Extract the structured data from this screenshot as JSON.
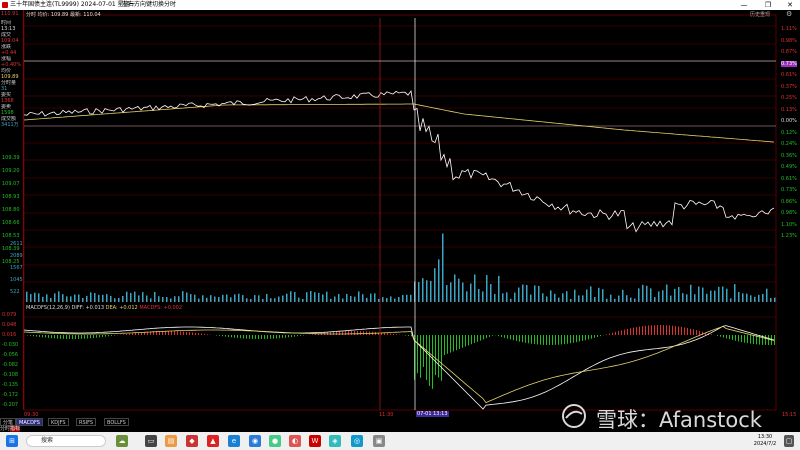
{
  "window": {
    "title": "三十年国债主连(TL9999) 2024-07-01 星期一",
    "subtitle": "左右方向键切换分时",
    "minimize": "—",
    "maximize": "❐",
    "close": "✕",
    "history_button": "历史重现"
  },
  "left_panel": {
    "top_price": "110.91",
    "rows": [
      {
        "label": "时间",
        "value": "13:13"
      },
      {
        "label": "成交",
        "value": "109.04"
      },
      {
        "label": "涨跌",
        "value": "+0.44"
      },
      {
        "label": "涨幅",
        "value": "+0.40%"
      },
      {
        "label": "均价",
        "value": "109.89"
      },
      {
        "label": "分时量",
        "value": "31"
      },
      {
        "label": "委买",
        "value": "1368"
      },
      {
        "label": "委卖",
        "value": "1598"
      },
      {
        "label": "成交额",
        "value": "3411万"
      }
    ]
  },
  "main_chart": {
    "legend": "分时 均价: 109.89 最新: 110.04",
    "left_ticks": [
      "109.39",
      "109.20",
      "109.07",
      "108.93",
      "108.80",
      "108.66",
      "108.53",
      "108.39",
      "108.25"
    ],
    "right_ticks": [
      "1.11%",
      "0.98%",
      "0.87%",
      "0.73%",
      "0.61%",
      "0.37%",
      "0.25%",
      "0.13%",
      "0.00%",
      "0.12%",
      "0.24%",
      "0.36%",
      "0.49%",
      "0.61%",
      "0.73%",
      "0.86%",
      "0.98%",
      "1.10%",
      "1.23%"
    ],
    "right_highlight": "0.73%",
    "volume_ticks": [
      "2611",
      "2089",
      "1567",
      "1045",
      "522"
    ]
  },
  "macd": {
    "legend_name": "MACDFS(12,26,9)",
    "diff": "DIFF: +0.013",
    "dea": "DEA: +0.012",
    "macd": "MACDFS: +0.002",
    "ticks": [
      "0.079",
      "0.048",
      "0.016",
      "-0.030",
      "-0.056",
      "-0.082",
      "-0.108",
      "-0.135",
      "-0.172",
      "-0.207"
    ]
  },
  "time_axis": {
    "start": "09:30",
    "mid": "11:30",
    "cursor": "07-01 13:13",
    "end": "15:15"
  },
  "tabs": [
    "分笔",
    "MACDFS",
    "KDJFS",
    "RSIFS",
    "BOLLFS"
  ],
  "active_tab": "MACDFS",
  "sub_tabs": [
    "分时",
    "指标"
  ],
  "taskbar": {
    "search_placeholder": "搜索",
    "time": "13:30",
    "date": "2024/7/2"
  },
  "watermark": "雪球：Afanstock",
  "colors": {
    "price_line": "#ffffff",
    "avg_line": "#e6d36a",
    "grid_red": "#8b0000",
    "cursor_red": "#d02020",
    "macd_up": "#e03030",
    "macd_down": "#20c020",
    "diff_line": "#ffffff",
    "dea_line": "#e6d36a",
    "tick_green": "#20c020",
    "tick_red": "#e03030",
    "volume_bar": "#3aa6c4"
  }
}
